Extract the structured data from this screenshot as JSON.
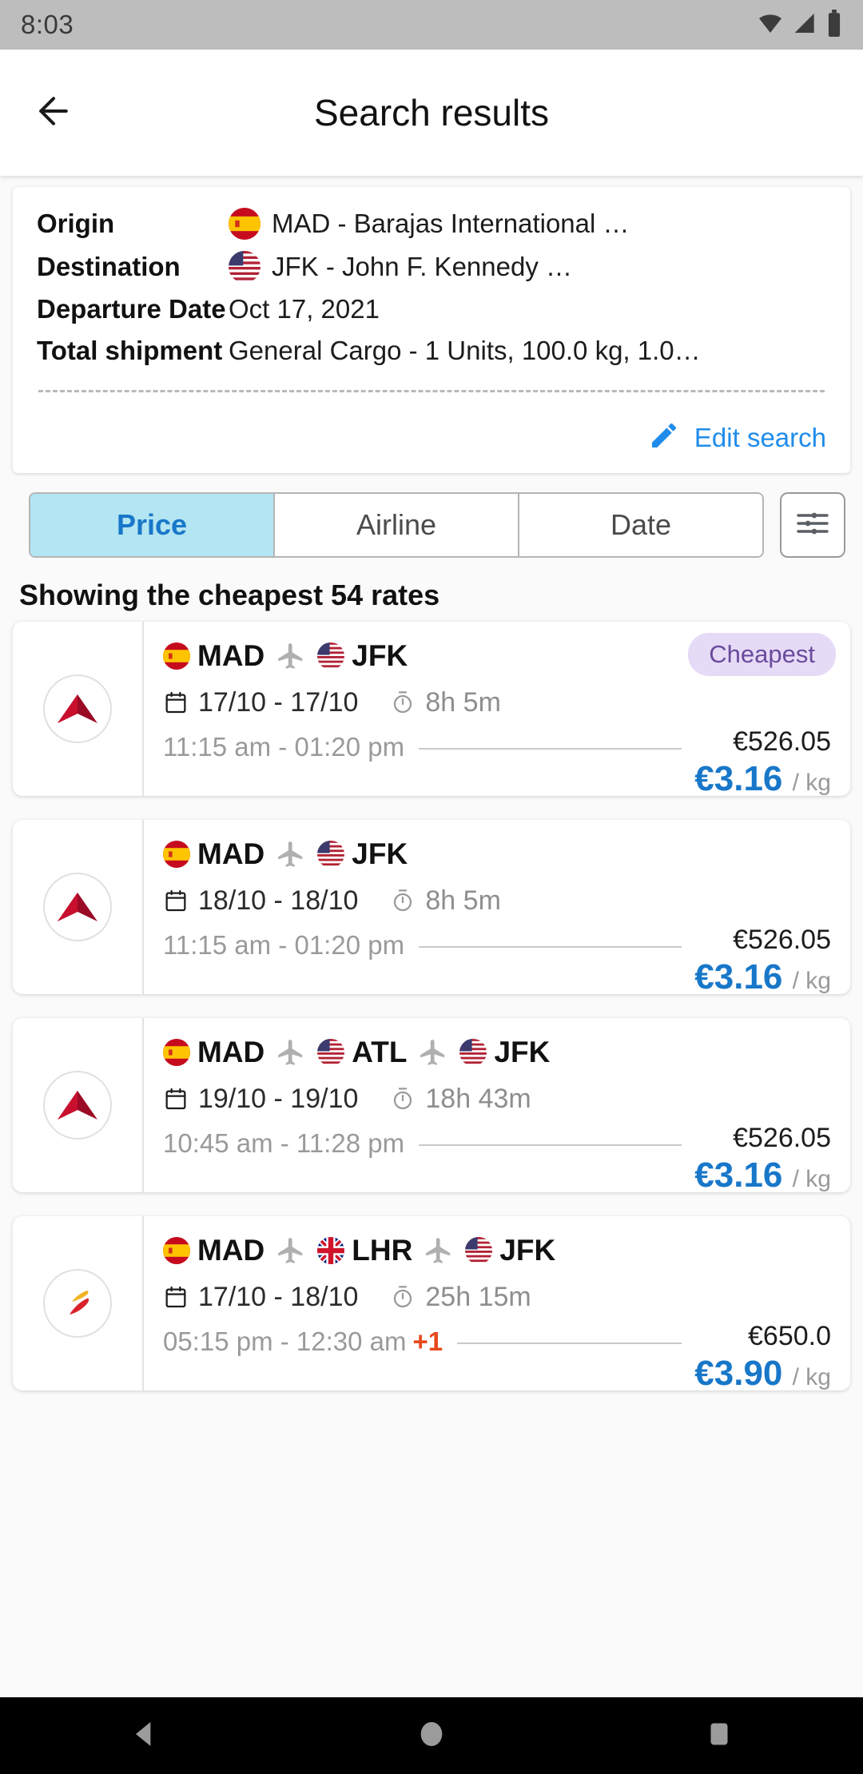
{
  "status_bar": {
    "time": "8:03",
    "icons": [
      "wifi-icon",
      "cell-signal-icon",
      "battery-icon"
    ]
  },
  "app_bar": {
    "title": "Search results",
    "back_icon": "arrow-left-icon"
  },
  "summary": {
    "rows": [
      {
        "label": "Origin",
        "value": "MAD - Barajas International …",
        "flag": "es"
      },
      {
        "label": "Destination",
        "value": "JFK - John F. Kennedy …",
        "flag": "us"
      },
      {
        "label": "Departure Date",
        "value": "Oct 17, 2021",
        "flag": ""
      },
      {
        "label": "Total shipment",
        "value": "General Cargo - 1 Units, 100.0 kg, 1.0…",
        "flag": ""
      }
    ],
    "edit_label": "Edit search",
    "edit_icon": "pencil-icon",
    "accent": "#1f8ceb"
  },
  "filters": {
    "tabs": [
      {
        "label": "Price",
        "active": true
      },
      {
        "label": "Airline",
        "active": false
      },
      {
        "label": "Date",
        "active": false
      }
    ],
    "filter_icon": "tune-icon",
    "active_bg": "#b3e5f2",
    "active_fg": "#1877c9"
  },
  "results_header": "Showing the cheapest 54 rates",
  "results": [
    {
      "airline": "delta",
      "badge": "Cheapest",
      "stops": [
        {
          "code": "MAD",
          "flag": "es"
        },
        {
          "code": "JFK",
          "flag": "us"
        }
      ],
      "dates": "17/10 - 17/10",
      "duration": "8h 5m",
      "times": "11:15 am - 01:20 pm",
      "day_offset": "",
      "price_total": "€526.05",
      "price_kg": "€3.16",
      "price_unit": "/ kg"
    },
    {
      "airline": "delta",
      "badge": "",
      "stops": [
        {
          "code": "MAD",
          "flag": "es"
        },
        {
          "code": "JFK",
          "flag": "us"
        }
      ],
      "dates": "18/10 - 18/10",
      "duration": "8h 5m",
      "times": "11:15 am - 01:20 pm",
      "day_offset": "",
      "price_total": "€526.05",
      "price_kg": "€3.16",
      "price_unit": "/ kg"
    },
    {
      "airline": "delta",
      "badge": "",
      "stops": [
        {
          "code": "MAD",
          "flag": "es"
        },
        {
          "code": "ATL",
          "flag": "us"
        },
        {
          "code": "JFK",
          "flag": "us"
        }
      ],
      "dates": "19/10 - 19/10",
      "duration": "18h 43m",
      "times": "10:45 am - 11:28 pm",
      "day_offset": "",
      "price_total": "€526.05",
      "price_kg": "€3.16",
      "price_unit": "/ kg"
    },
    {
      "airline": "iberia",
      "badge": "",
      "stops": [
        {
          "code": "MAD",
          "flag": "es"
        },
        {
          "code": "LHR",
          "flag": "gb"
        },
        {
          "code": "JFK",
          "flag": "us"
        }
      ],
      "dates": "17/10 - 18/10",
      "duration": "25h 15m",
      "times": "05:15 pm - 12:30 am",
      "day_offset": "+1",
      "price_total": "€650.0",
      "price_kg": "€3.90",
      "price_unit": "/ kg"
    }
  ],
  "nav_bar": {
    "buttons": [
      "back-triangle-icon",
      "home-circle-icon",
      "recents-square-icon"
    ]
  },
  "colors": {
    "accent_blue": "#1877c9",
    "badge_bg": "#e6dbf7",
    "badge_fg": "#6a4b9c",
    "day_offset": "#e8491d"
  }
}
